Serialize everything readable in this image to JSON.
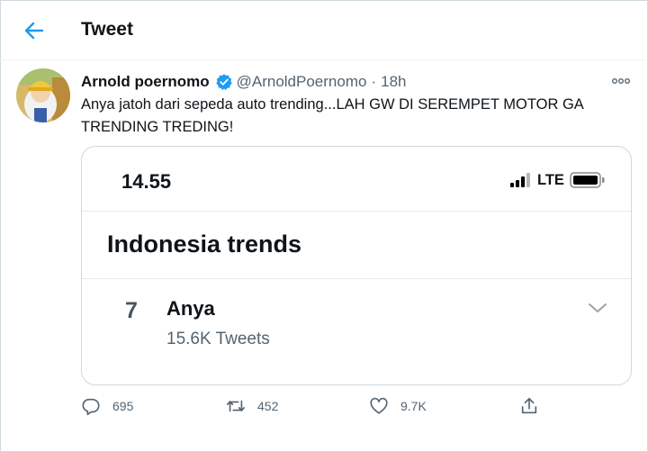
{
  "header": {
    "title": "Tweet",
    "back_icon": "arrow-left-icon",
    "accent_color": "#1d9bf0"
  },
  "tweet": {
    "author_name": "Arnold poernomo",
    "handle": "@ArnoldPoernomo",
    "separator": "·",
    "time": "18h",
    "text": "Anya jatoh dari sepeda auto trending...LAH GW DI SEREMPET MOTOR GA TRENDING TREDING!"
  },
  "embed": {
    "status_time": "14.55",
    "network": "LTE",
    "section_title": "Indonesia trends",
    "trend": {
      "rank": "7",
      "name": "Anya",
      "count": "15.6K Tweets"
    }
  },
  "actions": {
    "replies": "695",
    "retweets": "452",
    "likes": "9.7K"
  }
}
